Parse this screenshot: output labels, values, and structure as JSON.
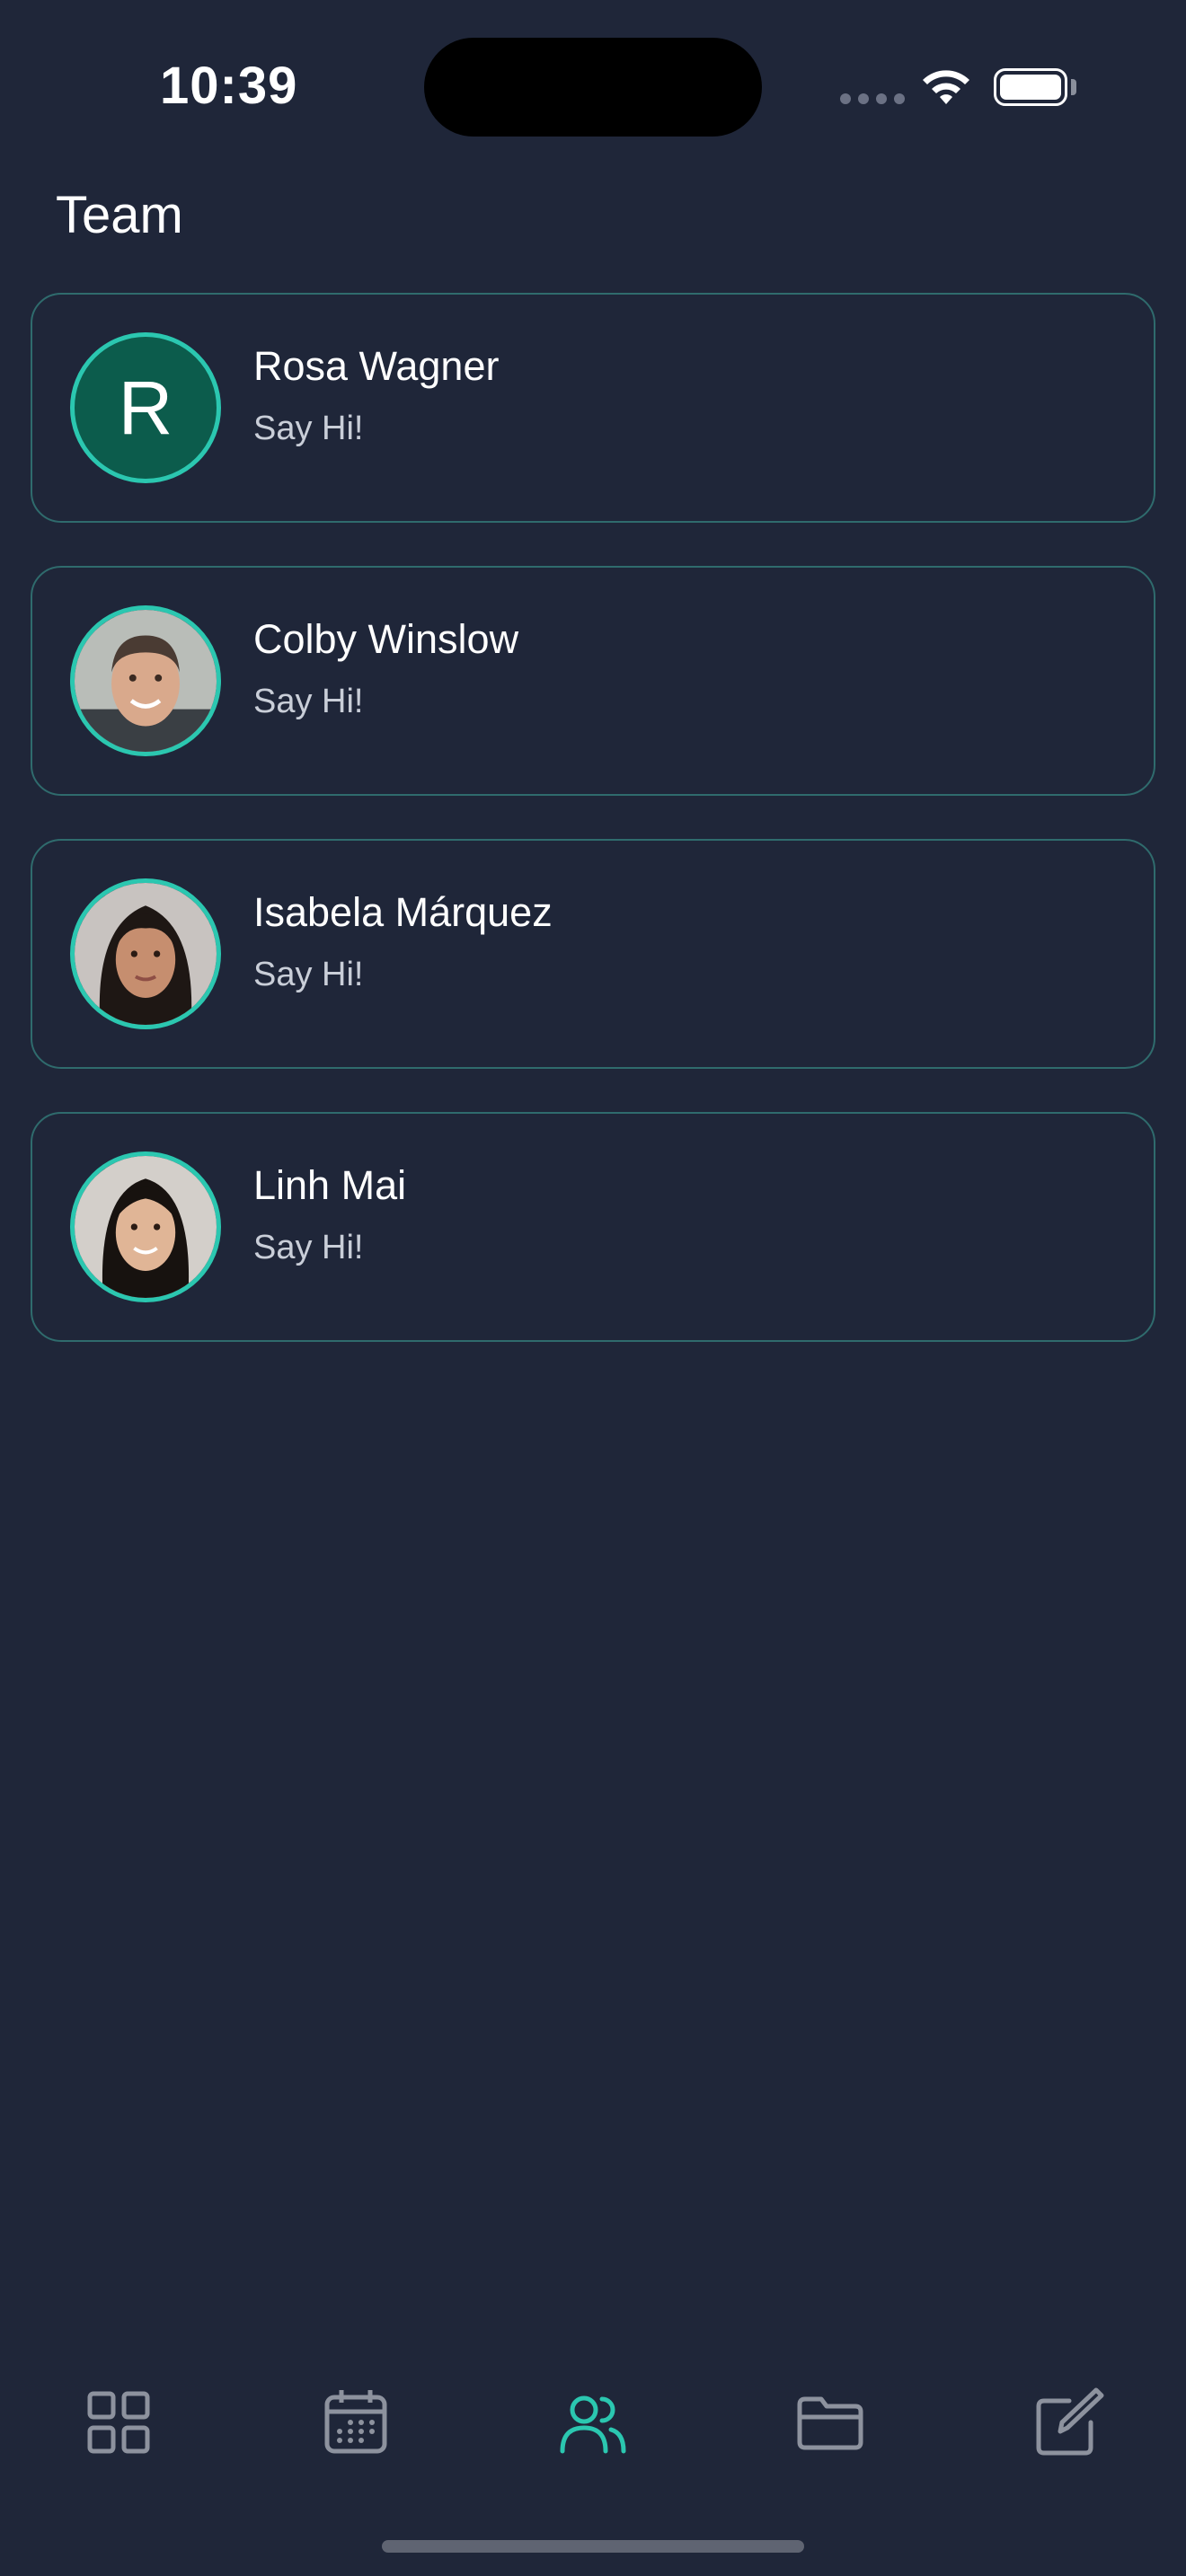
{
  "status_bar": {
    "time": "10:39"
  },
  "header": {
    "title": "Team"
  },
  "team": [
    {
      "name": "Rosa Wagner",
      "subtitle": "Say Hi!",
      "avatar": "initial",
      "initial": "R"
    },
    {
      "name": "Colby Winslow",
      "subtitle": "Say Hi!",
      "avatar": "photo-man"
    },
    {
      "name": "Isabela Márquez",
      "subtitle": "Say Hi!",
      "avatar": "photo-woman-1"
    },
    {
      "name": "Linh Mai",
      "subtitle": "Say Hi!",
      "avatar": "photo-woman-2"
    }
  ],
  "tab_bar": {
    "items": [
      {
        "icon": "grid-icon",
        "active": false
      },
      {
        "icon": "calendar-icon",
        "active": false
      },
      {
        "icon": "team-icon",
        "active": true
      },
      {
        "icon": "folder-icon",
        "active": false
      },
      {
        "icon": "compose-icon",
        "active": false
      }
    ]
  },
  "colors": {
    "background": "#1f2639",
    "accent": "#2bc7b0",
    "card_border": "#2f6b6d",
    "inactive_icon": "#8d929e"
  }
}
